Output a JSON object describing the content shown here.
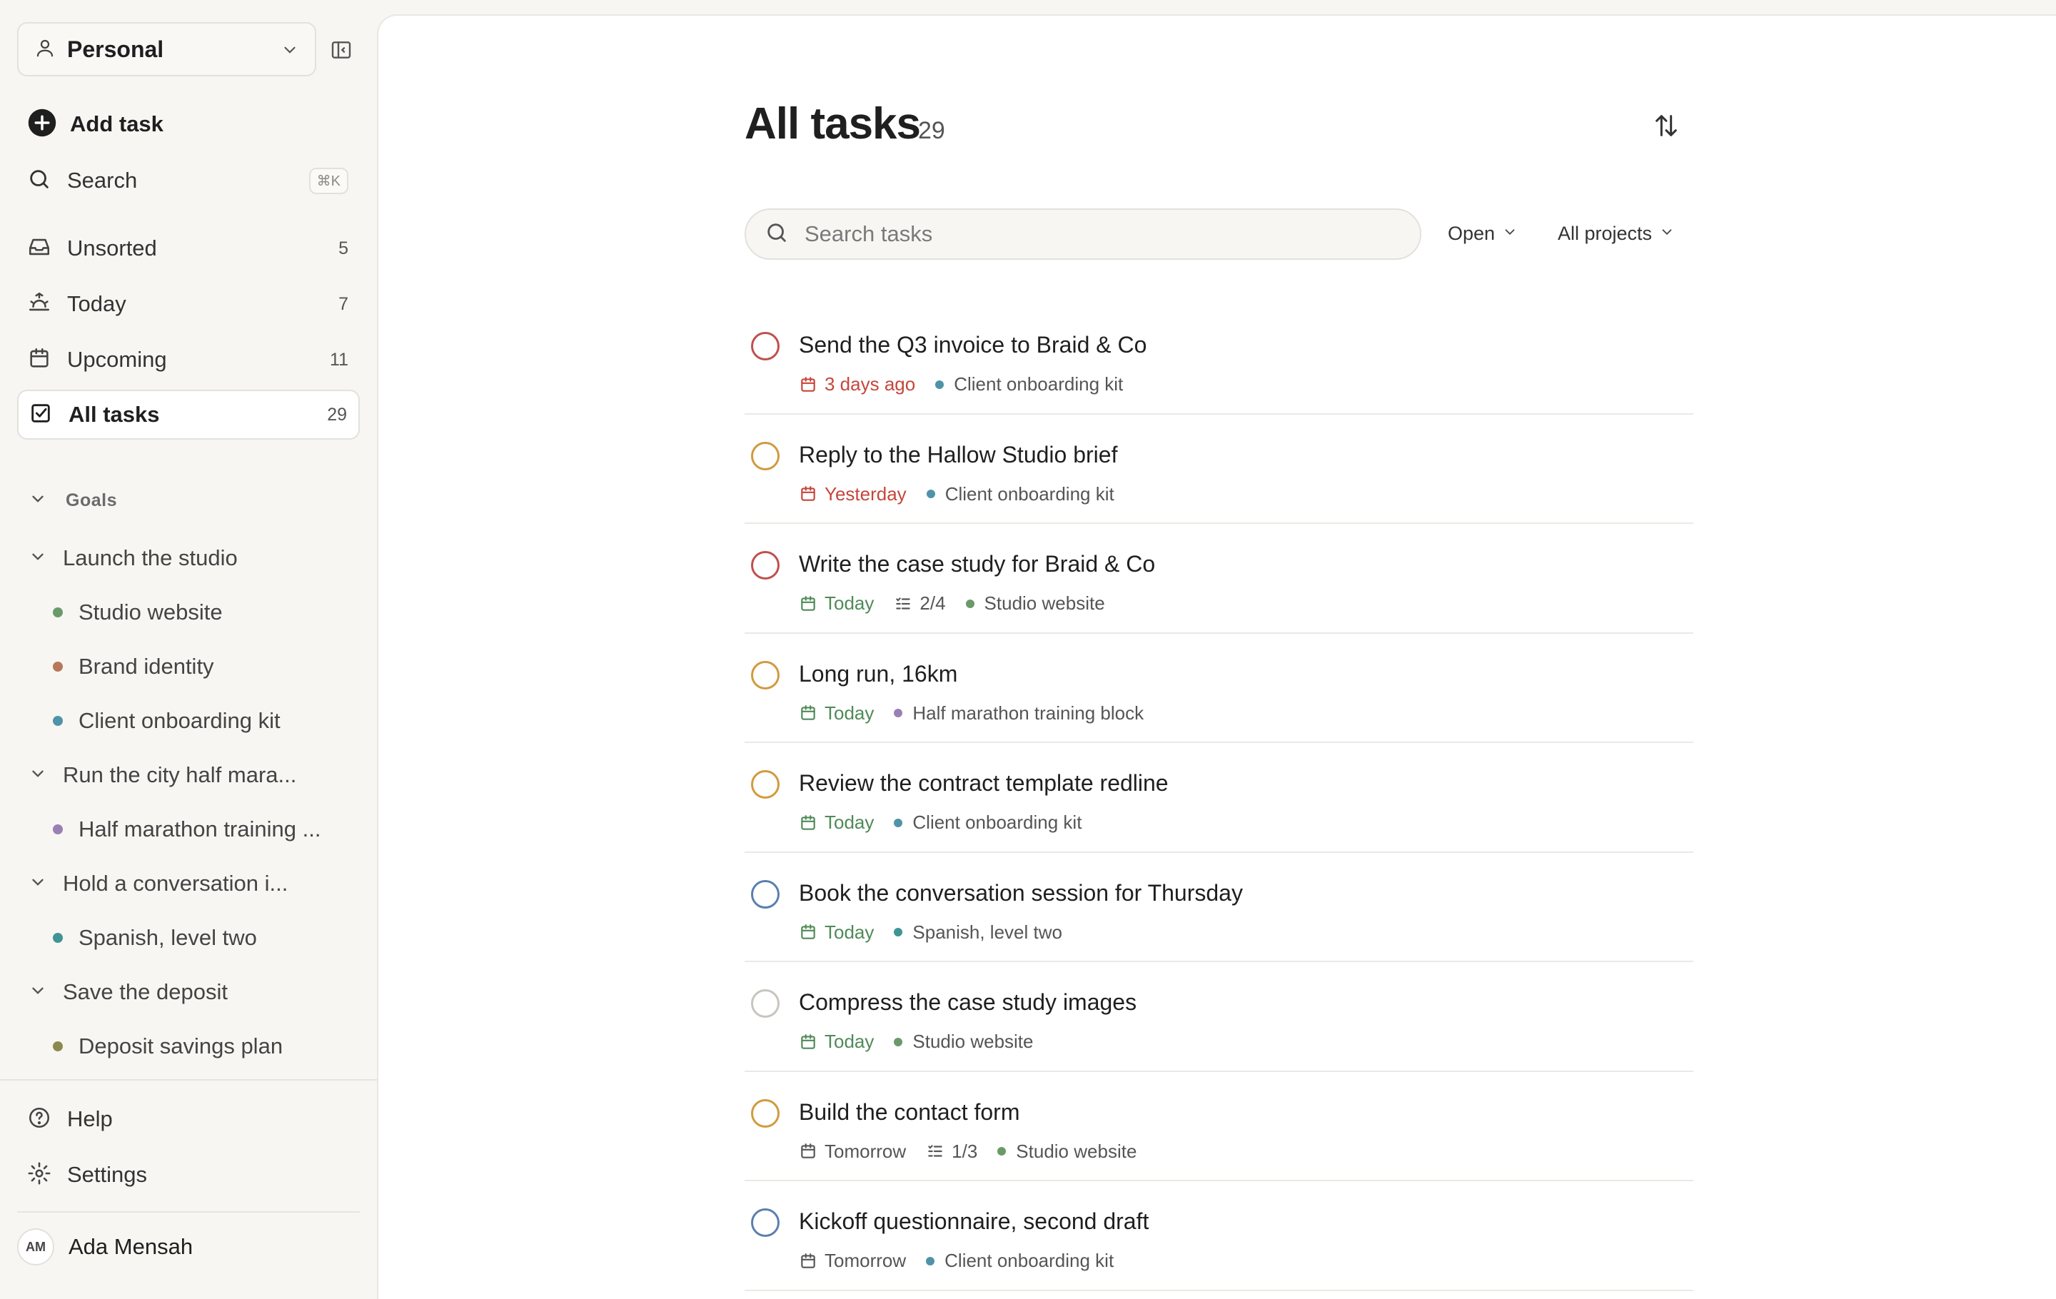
{
  "colors": {
    "overdue": "#c5473b",
    "today": "#4f8a58",
    "neutral": "#555555",
    "priority_high": "#c0504d",
    "priority_medium": "#d19a3e",
    "priority_low": "#5a7fb0",
    "priority_none": "#c8c5bf"
  },
  "sidebar": {
    "workspace": "Personal",
    "add_task": "Add task",
    "search": "Search",
    "search_shortcut": "⌘K",
    "nav": [
      {
        "label": "Unsorted",
        "count": "5",
        "icon": "inbox-icon"
      },
      {
        "label": "Today",
        "count": "7",
        "icon": "sunrise-icon"
      },
      {
        "label": "Upcoming",
        "count": "11",
        "icon": "calendar-icon"
      },
      {
        "label": "All tasks",
        "count": "29",
        "icon": "checkbox-icon"
      }
    ],
    "goals_title": "Goals",
    "goals": [
      {
        "label": "Launch the studio",
        "projects": [
          {
            "label": "Studio website",
            "color": "#6a9a6a"
          },
          {
            "label": "Brand identity",
            "color": "#b7775a"
          },
          {
            "label": "Client onboarding kit",
            "color": "#4f93a8"
          }
        ]
      },
      {
        "label": "Run the city half mara...",
        "projects": [
          {
            "label": "Half marathon training ...",
            "color": "#9a7fb4"
          }
        ]
      },
      {
        "label": "Hold a conversation i...",
        "projects": [
          {
            "label": "Spanish, level two",
            "color": "#3f9494"
          }
        ]
      },
      {
        "label": "Save the deposit",
        "projects": [
          {
            "label": "Deposit savings plan",
            "color": "#8a8a4e"
          }
        ]
      }
    ],
    "help": "Help",
    "settings": "Settings",
    "user": {
      "initials": "AM",
      "name": "Ada Mensah"
    }
  },
  "main": {
    "title": "All tasks",
    "count": "29",
    "search_placeholder": "Search tasks",
    "filter_status": "Open",
    "filter_projects": "All projects",
    "tasks": [
      {
        "title": "Send the Q3 invoice to Braid & Co",
        "due": "3 days ago",
        "due_state": "overdue",
        "subtasks": "",
        "project": "Client onboarding kit",
        "project_color": "#4f93a8",
        "priority": "high"
      },
      {
        "title": "Reply to the Hallow Studio brief",
        "due": "Yesterday",
        "due_state": "overdue",
        "subtasks": "",
        "project": "Client onboarding kit",
        "project_color": "#4f93a8",
        "priority": "medium"
      },
      {
        "title": "Write the case study for Braid & Co",
        "due": "Today",
        "due_state": "today",
        "subtasks": "2/4",
        "project": "Studio website",
        "project_color": "#6a9a6a",
        "priority": "high"
      },
      {
        "title": "Long run, 16km",
        "due": "Today",
        "due_state": "today",
        "subtasks": "",
        "project": "Half marathon training block",
        "project_color": "#9a7fb4",
        "priority": "medium"
      },
      {
        "title": "Review the contract template redline",
        "due": "Today",
        "due_state": "today",
        "subtasks": "",
        "project": "Client onboarding kit",
        "project_color": "#4f93a8",
        "priority": "medium"
      },
      {
        "title": "Book the conversation session for Thursday",
        "due": "Today",
        "due_state": "today",
        "subtasks": "",
        "project": "Spanish, level two",
        "project_color": "#3f9494",
        "priority": "low"
      },
      {
        "title": "Compress the case study images",
        "due": "Today",
        "due_state": "today",
        "subtasks": "",
        "project": "Studio website",
        "project_color": "#6a9a6a",
        "priority": "none"
      },
      {
        "title": "Build the contact form",
        "due": "Tomorrow",
        "due_state": "future",
        "subtasks": "1/3",
        "project": "Studio website",
        "project_color": "#6a9a6a",
        "priority": "medium"
      },
      {
        "title": "Kickoff questionnaire, second draft",
        "due": "Tomorrow",
        "due_state": "future",
        "subtasks": "",
        "project": "Client onboarding kit",
        "project_color": "#4f93a8",
        "priority": "low"
      }
    ]
  }
}
